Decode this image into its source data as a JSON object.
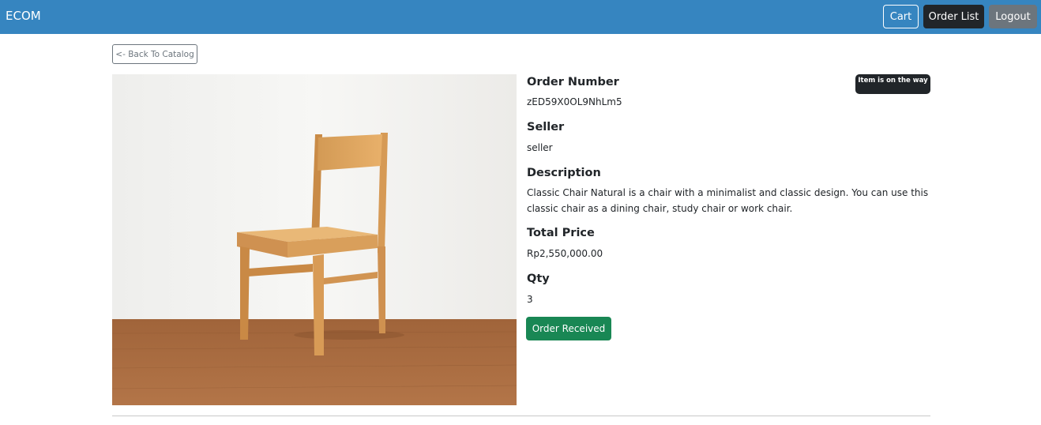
{
  "navbar": {
    "brand": "ECOM",
    "cart_label": "Cart",
    "orders_label": "Order List",
    "logout_label": "Logout"
  },
  "back_label": "<- Back To Catalog",
  "order": {
    "status": "Item is on the way",
    "number_label": "Order Number",
    "number": "zED59X0OL9NhLm5",
    "seller_label": "Seller",
    "seller": "seller",
    "description_label": "Description",
    "description": "Classic Chair Natural is a chair with a minimalist and classic design. You can use this classic chair as a dining chair, study chair or work chair.",
    "total_label": "Total Price",
    "total": "Rp2,550,000.00",
    "qty_label": "Qty",
    "qty": "3",
    "action_label": "Order Received"
  },
  "colors": {
    "navbar": "#3685c0",
    "badge": "#212529",
    "success": "#198754"
  }
}
